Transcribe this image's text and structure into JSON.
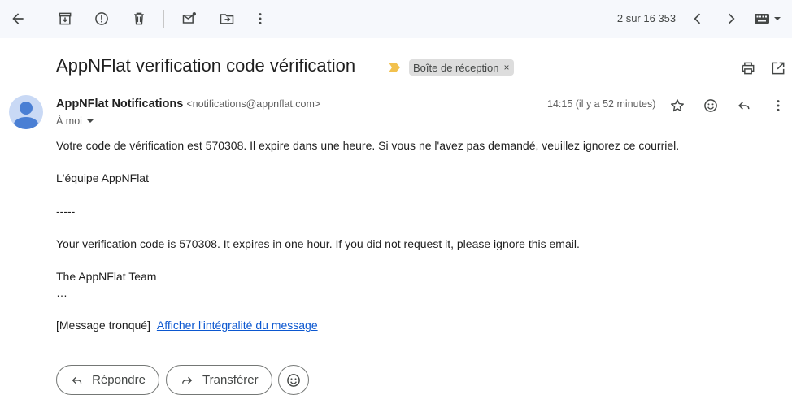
{
  "toolbar": {
    "icons": [
      "back-arrow-icon",
      "archive-icon",
      "report-spam-icon",
      "delete-icon",
      "mark-unread-icon",
      "move-to-icon",
      "more-vertical-icon"
    ],
    "pager_text": "2 sur 16 353"
  },
  "email": {
    "subject": "AppNFlat verification code vérification",
    "label": "Boîte de réception",
    "label_remove": "×",
    "sender_name": "AppNFlat Notifications",
    "sender_email": "<notifications@appnflat.com>",
    "recipient": "À moi",
    "time": "14:15 (il y a 52 minutes)",
    "body": {
      "line1": "Votre code de vérification est 570308. Il expire dans une heure. Si vous ne l'avez pas demandé, veuillez ignorez ce courriel.",
      "line2": "L'équipe AppNFlat",
      "separator": "-----",
      "line3": "Your verification code is 570308. It expires in one hour. If you did not request it, please ignore this email.",
      "line4": "The AppNFlat Team",
      "ellipsis": "…",
      "truncated": "[Message tronqué]",
      "view_full": "Afficher l'intégralité du message"
    }
  },
  "actions": {
    "reply": "Répondre",
    "forward": "Transférer"
  },
  "colors": {
    "toolbar_bg": "#f6f8fc",
    "link": "#0b57d0",
    "importance_marker": "#f2c14e",
    "avatar_bg": "#c9d9f5",
    "avatar_fg": "#4a7fd4"
  }
}
